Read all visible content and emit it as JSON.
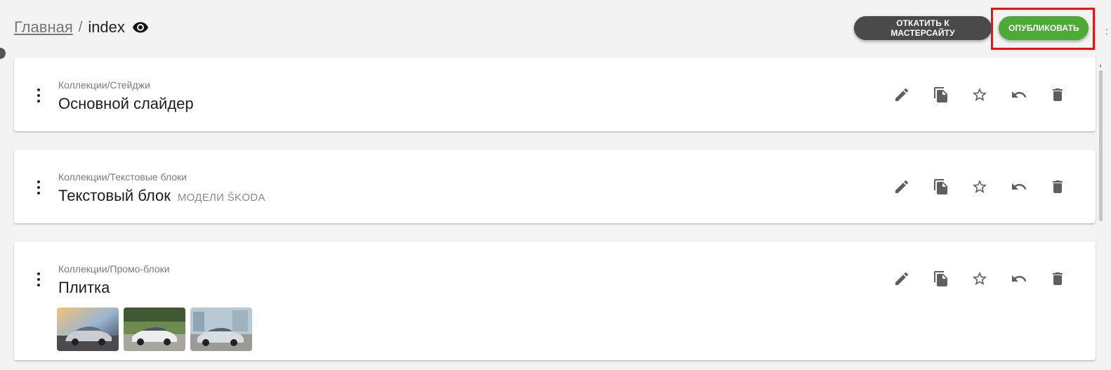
{
  "breadcrumb": {
    "home_label": "Главная",
    "separator": "/",
    "current": "index"
  },
  "header": {
    "rollback_label": "ОТКАТИТЬ К МАСТЕРСАЙТУ",
    "publish_label": "ОПУБЛИКОВАТЬ",
    "highlight_color": "#ee1111"
  },
  "colors": {
    "rollback_bg": "#4a4a4a",
    "publish_bg": "#4caa35",
    "background": "#f3f3f3",
    "icon": "#5f5f5f"
  },
  "actions_icons": [
    "edit-icon",
    "copy-icon",
    "star-icon",
    "undo-icon",
    "delete-icon"
  ],
  "blocks": [
    {
      "path": "Коллекции/Стейджи",
      "title": "Основной слайдер",
      "subtitle": ""
    },
    {
      "path": "Коллекции/Текстовые блоки",
      "title": "Текстовый блок",
      "subtitle": "МОДЕЛИ ŠKODA"
    },
    {
      "path": "Коллекции/Промо-блоки",
      "title": "Плитка",
      "subtitle": "",
      "thumbnails": [
        "car-thumbnail-1",
        "car-thumbnail-2",
        "car-thumbnail-3"
      ]
    }
  ]
}
